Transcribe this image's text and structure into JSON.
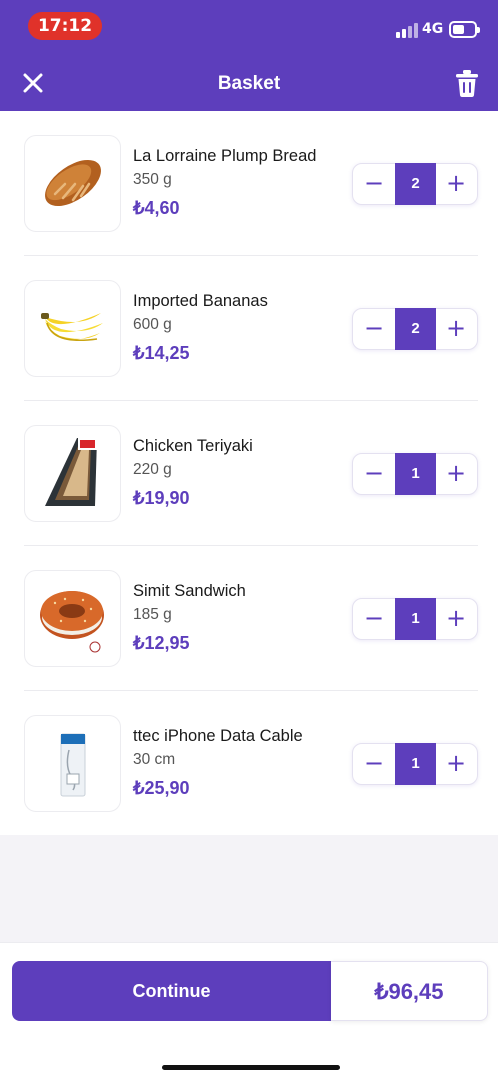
{
  "status_bar": {
    "time": "17:12",
    "network": "4G"
  },
  "header": {
    "title": "Basket",
    "close_icon": "close-icon",
    "trash_icon": "trash-icon"
  },
  "colors": {
    "brand": "#5d3ebc",
    "time_pill": "#e0322a"
  },
  "items": [
    {
      "name": "La Lorraine Plump Bread",
      "quantity_text": "350 g",
      "price": "₺4,60",
      "count": "2",
      "icon": "bread-image"
    },
    {
      "name": "Imported Bananas",
      "quantity_text": "600 g",
      "price": "₺14,25",
      "count": "2",
      "icon": "banana-image"
    },
    {
      "name": "Chicken Teriyaki",
      "quantity_text": "220 g",
      "price": "₺19,90",
      "count": "1",
      "icon": "sandwich-image"
    },
    {
      "name": "Simit Sandwich",
      "quantity_text": "185 g",
      "price": "₺12,95",
      "count": "1",
      "icon": "simit-image"
    },
    {
      "name": "ttec iPhone Data Cable",
      "quantity_text": "30 cm",
      "price": "₺25,90",
      "count": "1",
      "icon": "cable-image"
    }
  ],
  "stepper": {
    "minus": "−",
    "plus": "+"
  },
  "footer": {
    "continue_label": "Continue",
    "total": "₺96,45"
  }
}
